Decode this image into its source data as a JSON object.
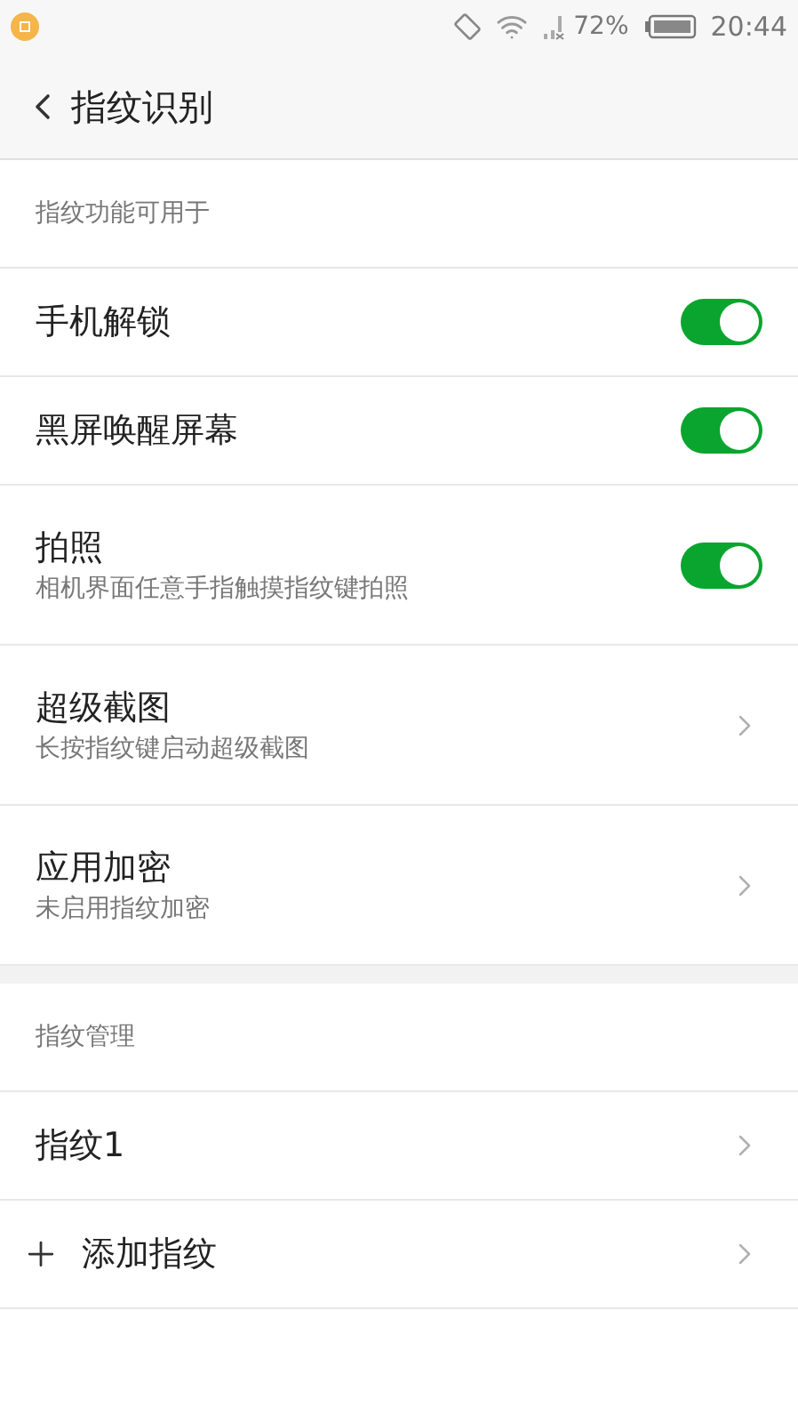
{
  "status_bar": {
    "battery": "72%",
    "time": "20:44"
  },
  "header": {
    "title": "指纹识别"
  },
  "sections": [
    {
      "title": "指纹功能可用于",
      "items": [
        {
          "kind": "toggle",
          "label": "手机解锁",
          "on": true
        },
        {
          "kind": "toggle",
          "label": "黑屏唤醒屏幕",
          "on": true
        },
        {
          "kind": "toggle",
          "label": "拍照",
          "subtitle": "相机界面任意手指触摸指纹键拍照",
          "on": true
        },
        {
          "kind": "link",
          "label": "超级截图",
          "subtitle": "长按指纹键启动超级截图"
        },
        {
          "kind": "link",
          "label": "应用加密",
          "subtitle": "未启用指纹加密"
        }
      ]
    },
    {
      "title": "指纹管理",
      "items": [
        {
          "kind": "link",
          "label": "指纹1"
        },
        {
          "kind": "add",
          "label": "添加指纹"
        }
      ]
    }
  ]
}
